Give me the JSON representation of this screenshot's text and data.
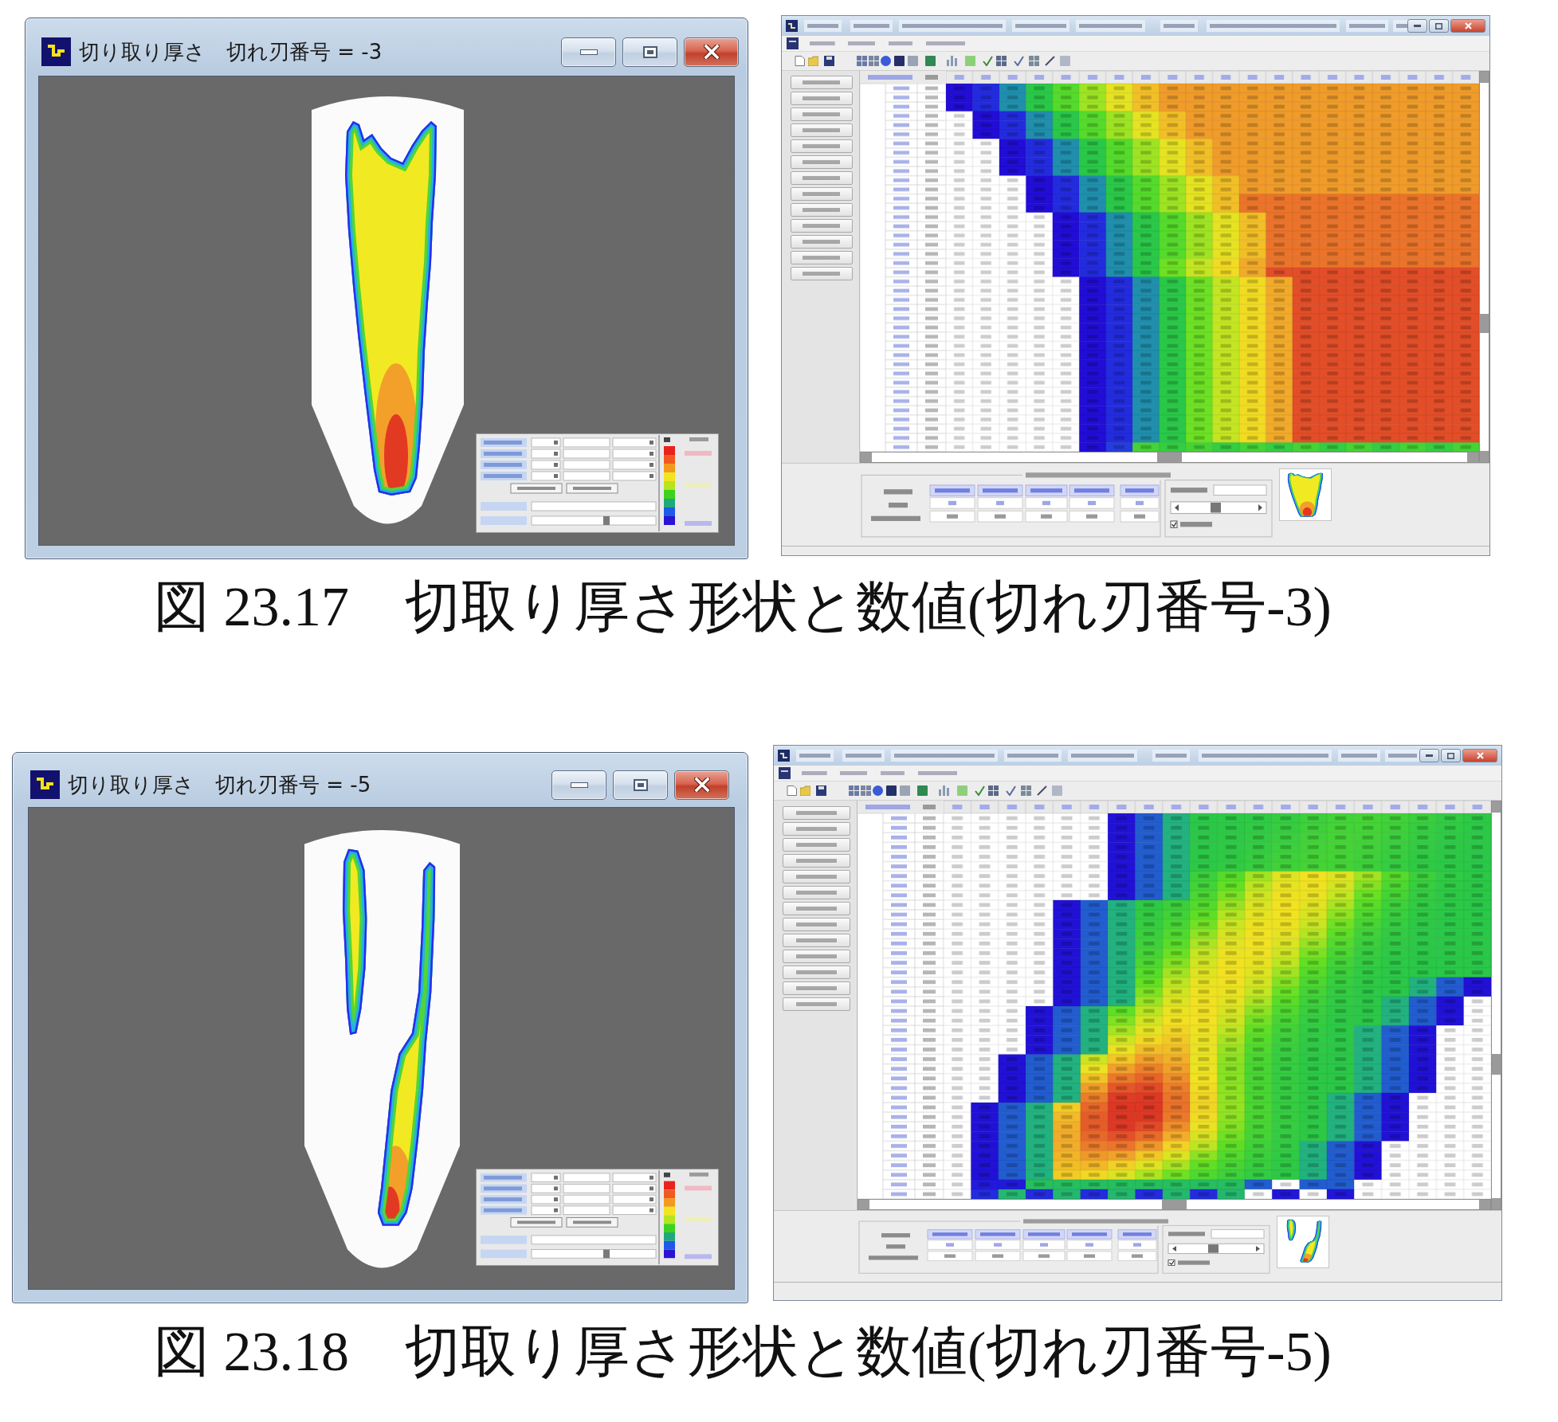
{
  "figures": [
    {
      "shape_window": {
        "title": "切り取り厚さ　切れ刃番号 = -3"
      },
      "caption": "図 23.17　切取り厚さ形状と数値(切れ刃番号-3)"
    },
    {
      "shape_window": {
        "title": "切り取り厚さ　切れ刃番号 = -5"
      },
      "caption": "図 23.18　切取り厚さ形状と数値(切れ刃番号-5)"
    }
  ]
}
